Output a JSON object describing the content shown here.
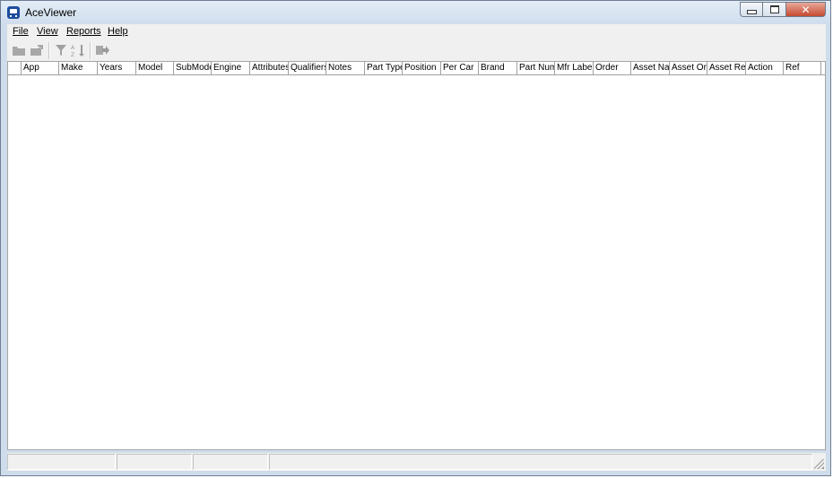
{
  "window": {
    "title": "AceViewer"
  },
  "menu": [
    {
      "label": "File"
    },
    {
      "label": "View"
    },
    {
      "label": "Reports"
    },
    {
      "label": "Help"
    }
  ],
  "toolbar": {
    "icons": [
      "folder-open-icon",
      "export-icon",
      "filter-icon",
      "sort-icon",
      "run-icon"
    ]
  },
  "grid": {
    "columns": [
      "App",
      "Make",
      "Years",
      "Model",
      "SubMode",
      "Engine",
      "Attributes",
      "Qualifiers",
      "Notes",
      "Part Type",
      "Position",
      "Per Car",
      "Brand",
      "Part Numb",
      "Mfr Label",
      "Order",
      "Asset Na",
      "Asset Or",
      "Asset Re",
      "Action",
      "Ref"
    ],
    "rows": []
  },
  "statusbar": {
    "panels": [
      "",
      "",
      "",
      ""
    ]
  }
}
